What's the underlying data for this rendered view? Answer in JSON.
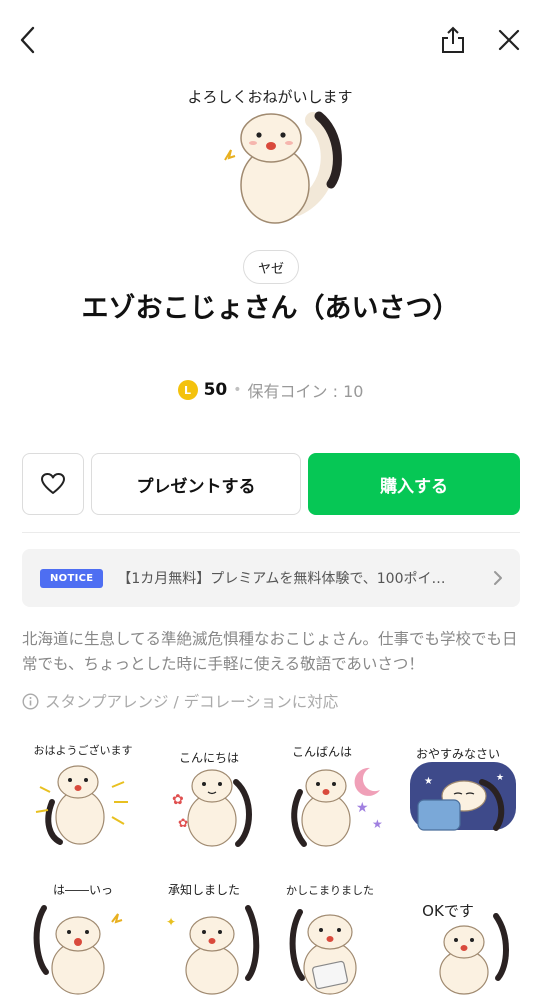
{
  "header": {
    "back_icon": "chevron-left-icon",
    "share_icon": "share-icon",
    "close_icon": "close-icon"
  },
  "main_sticker": {
    "caption": "よろしくおねがいします"
  },
  "author": "ヤゼ",
  "title": "エゾおこじょさん（あいさつ）",
  "price": {
    "icon_letter": "L",
    "amount": "50",
    "separator": "•",
    "owned": "保有コイン : 10"
  },
  "actions": {
    "present_label": "プレゼントする",
    "buy_label": "購入する",
    "favorite_icon": "heart-icon"
  },
  "notice": {
    "badge": "NOTICE",
    "text": "【1カ月無料】プレミアムを無料体験で、100ポイ…"
  },
  "description": "北海道に生息してる準絶滅危惧種なおこじょさん。仕事でも学校でも日常でも、ちょっとした時に手軽に使える敬語であいさつ！",
  "arrange_note": "スタンプアレンジ / デコレーションに対応",
  "stickers": [
    {
      "caption": "おはようございます"
    },
    {
      "caption": "こんにちは"
    },
    {
      "caption": "こんばんは"
    },
    {
      "caption": "おやすみなさい"
    },
    {
      "caption": "は――いっ"
    },
    {
      "caption": "承知しました"
    },
    {
      "caption": "かしこまりました"
    },
    {
      "caption": "OKです"
    }
  ],
  "colors": {
    "buy": "#06c755",
    "notice_badge": "#4e6ef2",
    "coin": "#f4c20d"
  }
}
